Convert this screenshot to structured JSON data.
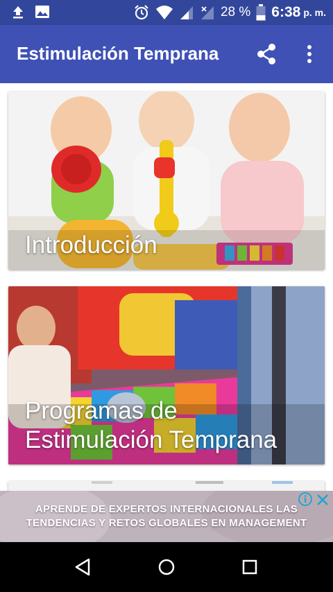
{
  "status_bar": {
    "battery_percent": "28 %",
    "time": "6:38",
    "ampm": "p. m.",
    "icons": [
      "upload-icon",
      "image-icon",
      "alarm-icon",
      "wifi-icon",
      "signal-icon",
      "signal-x-icon",
      "battery-icon"
    ]
  },
  "app_bar": {
    "title": "Estimulación Temprana",
    "actions": [
      "share-icon",
      "overflow-menu-icon"
    ]
  },
  "cards": [
    {
      "title": "Introducción"
    },
    {
      "title": "Programas de Estimulación Temprana"
    }
  ],
  "ad": {
    "line1": "APRENDE DE EXPERTOS INTERNACIONALES LAS",
    "line2": "TENDENCIAS Y RETOS GLOBALES EN MANAGEMENT",
    "icons": [
      "ad-info-icon",
      "ad-close-icon"
    ]
  },
  "nav_bar": {
    "buttons": [
      "back-icon",
      "home-icon",
      "recent-apps-icon"
    ]
  },
  "colors": {
    "status_bar": "#32479c",
    "app_bar": "#3f51b5",
    "nav_bar": "#000000"
  }
}
